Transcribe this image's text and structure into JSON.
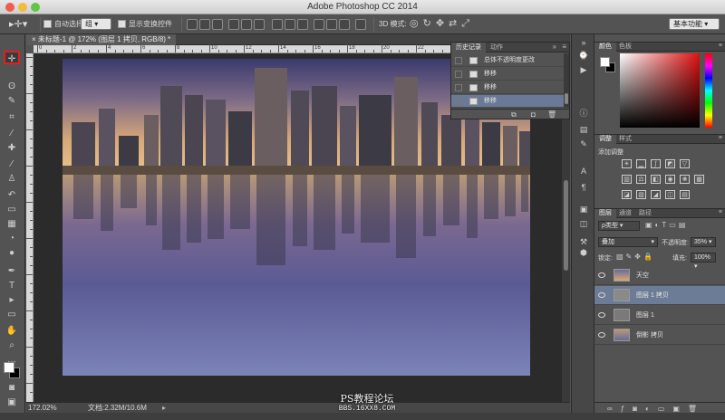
{
  "window": {
    "title": "Adobe Photoshop CC 2014"
  },
  "options": {
    "auto_select_label": "自动选择:",
    "auto_select_value": "组",
    "show_transform_label": "显示变换控件",
    "mode_3d_label": "3D 模式:",
    "workspace_value": "基本功能"
  },
  "document": {
    "tab_title": "未标题-1 @ 172% (图层 1 拷贝, RGB/8) *",
    "zoom": "172.02%",
    "doc_size": "文档:2.32M/10.6M"
  },
  "history": {
    "tabs": [
      "历史记录",
      "动作"
    ],
    "items": [
      {
        "label": "总体不透明度更改",
        "selected": false
      },
      {
        "label": "移移",
        "selected": false
      },
      {
        "label": "移移",
        "selected": false
      },
      {
        "label": "移移",
        "selected": true
      }
    ]
  },
  "color_panel": {
    "tabs": [
      "颜色",
      "色板"
    ],
    "foreground": "#ffffff",
    "background": "#000000",
    "accent": "#e01010"
  },
  "adjustments": {
    "tabs": [
      "调整",
      "样式"
    ],
    "title": "添加调整"
  },
  "layers_panel": {
    "tabs": [
      "图层",
      "通道",
      "路径"
    ],
    "filter_label": "ρ类型",
    "blend_mode": "叠加",
    "opacity_label": "不透明度:",
    "opacity_value": "35%",
    "lock_label": "锁定:",
    "fill_label": "填充:",
    "fill_value": "100%",
    "layers": [
      {
        "name": "天空",
        "selected": false
      },
      {
        "name": "图层 1 拷贝",
        "selected": true
      },
      {
        "name": "图层 1",
        "selected": false
      },
      {
        "name": "倒影 拷贝",
        "selected": false
      }
    ]
  },
  "watermark": {
    "line1": "PS教程论坛",
    "line2": "BBS.16XX8.COM"
  },
  "ruler_numbers": [
    "0",
    "2",
    "4",
    "6",
    "8",
    "10",
    "12",
    "14",
    "16",
    "18",
    "20",
    "22",
    "24",
    "26",
    "28"
  ]
}
